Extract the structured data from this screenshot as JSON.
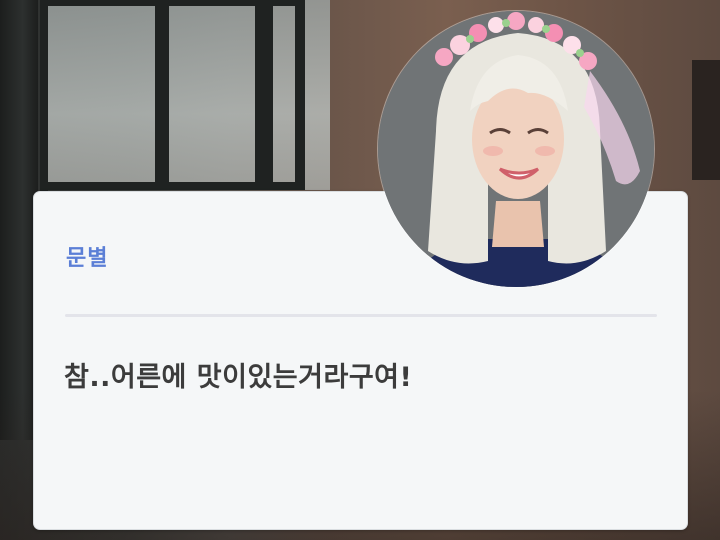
{
  "dialog": {
    "speaker_name": "문별",
    "message": "참..어른에 맛이있는거라구여!",
    "name_color": "#5b7fd6",
    "text_color": "#3c3c3c",
    "card_background": "#f5f7f8"
  },
  "avatar": {
    "icon": "portrait-photo"
  }
}
